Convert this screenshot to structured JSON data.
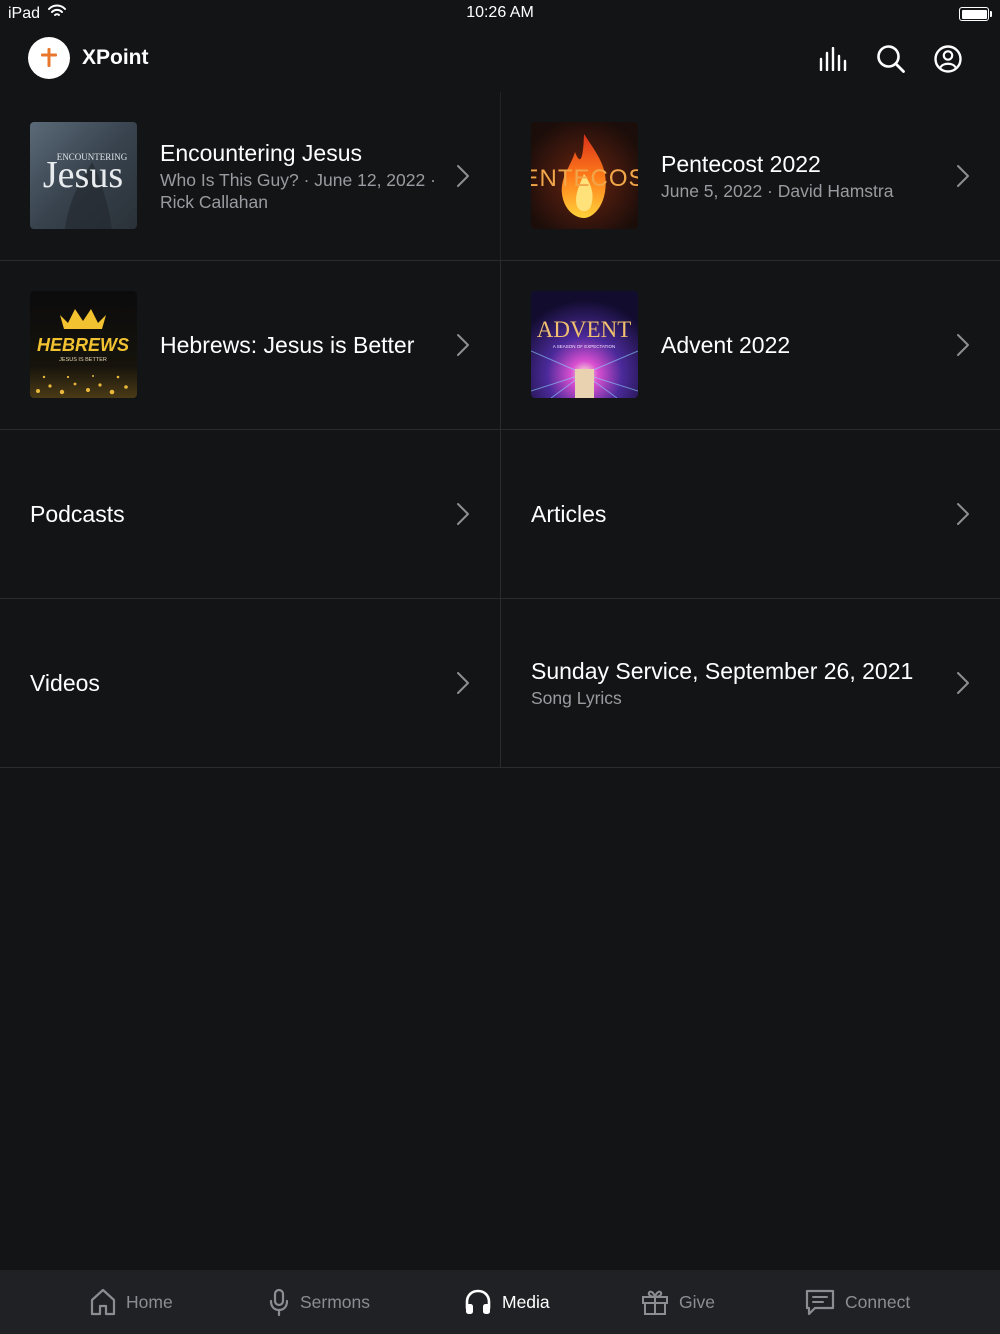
{
  "status_bar": {
    "device": "iPad",
    "time": "10:26 AM"
  },
  "header": {
    "app_name": "XPoint",
    "actions": [
      "now-playing",
      "search",
      "account"
    ]
  },
  "items": [
    {
      "title": "Encountering Jesus",
      "subtitle": "Who Is This Guy? · June 12, 2022 · Rick Callahan",
      "artwork_text": "ENCOUNTERING Jesus"
    },
    {
      "title": "Pentecost 2022",
      "subtitle": "June 5, 2022 · David Hamstra",
      "artwork_text": "PENTECOS"
    },
    {
      "title": "Hebrews: Jesus is Better",
      "subtitle": "",
      "artwork_text": "HEBREWS",
      "artwork_subtext": "JESUS IS BETTER"
    },
    {
      "title": "Advent 2022",
      "subtitle": "",
      "artwork_text": "ADVENT",
      "artwork_subtext": "A SEASON OF EXPECTATION"
    },
    {
      "title": "Podcasts",
      "subtitle": ""
    },
    {
      "title": "Articles",
      "subtitle": ""
    },
    {
      "title": "Videos",
      "subtitle": ""
    },
    {
      "title": "Sunday Service, September 26, 2021",
      "subtitle": "Song Lyrics"
    }
  ],
  "tabs": [
    {
      "label": "Home",
      "icon": "home-icon",
      "active": false
    },
    {
      "label": "Sermons",
      "icon": "microphone-icon",
      "active": false
    },
    {
      "label": "Media",
      "icon": "headphones-icon",
      "active": true
    },
    {
      "label": "Give",
      "icon": "gift-icon",
      "active": false
    },
    {
      "label": "Connect",
      "icon": "message-icon",
      "active": false
    }
  ],
  "colors": {
    "background": "#131416",
    "tab_bar": "#202124",
    "accent": "#e8772e",
    "muted_text": "#9a9ba0"
  }
}
